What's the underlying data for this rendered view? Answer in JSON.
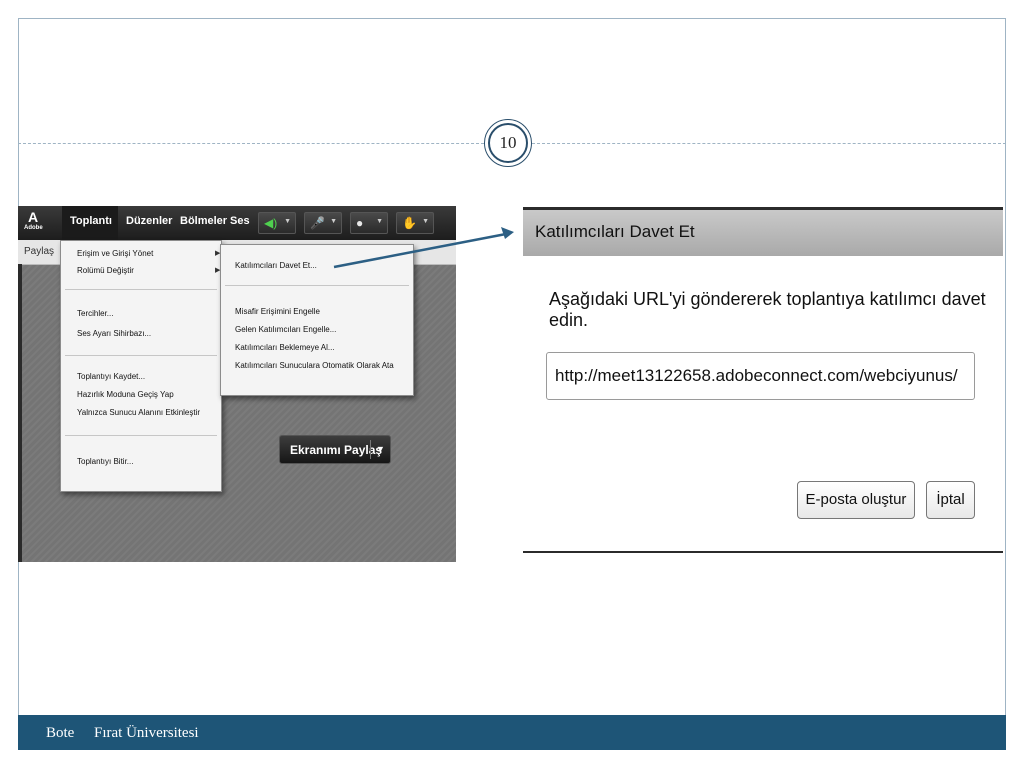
{
  "slide": {
    "number": "10",
    "footer": {
      "author": "Bote",
      "institution": "Fırat Üniversitesi"
    },
    "accent_color": "#1e5577"
  },
  "left_screenshot": {
    "brand": {
      "logo_glyph": "A",
      "logo_text": "Adobe"
    },
    "menubar": {
      "items": [
        "Toplantı",
        "Düzenler",
        "Bölmeler",
        "Ses"
      ],
      "toolbar_icons": [
        "speaker-icon",
        "microphone-icon",
        "webcam-icon",
        "raise-hand-icon"
      ]
    },
    "subbar_label": "Paylaş",
    "dropdown": {
      "items": [
        "Erişim ve Girişi Yönet",
        "Rolümü Değiştir",
        "Tercihler...",
        "Ses Ayarı Sihirbazı...",
        "Toplantıyı Kaydet...",
        "Hazırlık Moduna Geçiş Yap",
        "Yalnızca Sunucu Alanını Etkinleştir",
        "Toplantıyı Bitir..."
      ]
    },
    "submenu": {
      "items": [
        "Katılımcıları Davet Et...",
        "Misafir Erişimini Engelle",
        "Gelen Katılımcıları Engelle...",
        "Katılımcıları Beklemeye Al...",
        "Katılımcıları Sunuculara Otomatik Olarak Ata"
      ]
    },
    "share_button": "Ekranımı Paylaş"
  },
  "dialog": {
    "title": "Katılımcıları Davet Et",
    "message": "Aşağıdaki URL'yi göndererek toplantıya katılımcı davet edin.",
    "url": "http://meet13122658.adobeconnect.com/webciyunus/",
    "buttons": {
      "create_email": "E-posta oluştur",
      "cancel": "İptal"
    }
  }
}
